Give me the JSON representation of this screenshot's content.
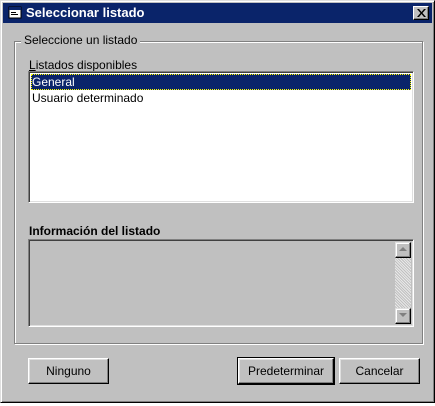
{
  "window": {
    "title": "Seleccionar listado"
  },
  "group": {
    "legend": "Seleccione un listado"
  },
  "list": {
    "label_access": "L",
    "label_rest": "istados disponibles",
    "items": [
      "General",
      "Usuario determinado"
    ],
    "selected_index": 0
  },
  "info": {
    "label": "Información del listado",
    "text": ""
  },
  "buttons": {
    "none": "Ninguno",
    "default": "Predeterminar",
    "cancel": "Cancelar"
  },
  "colors": {
    "titlebar": "#0a246a",
    "face": "#c0c0c0",
    "selection": "#0a246a"
  },
  "icons": {
    "title": "app-window-icon",
    "close": "close-icon",
    "scroll_up": "arrow-up-icon",
    "scroll_down": "arrow-down-icon"
  }
}
